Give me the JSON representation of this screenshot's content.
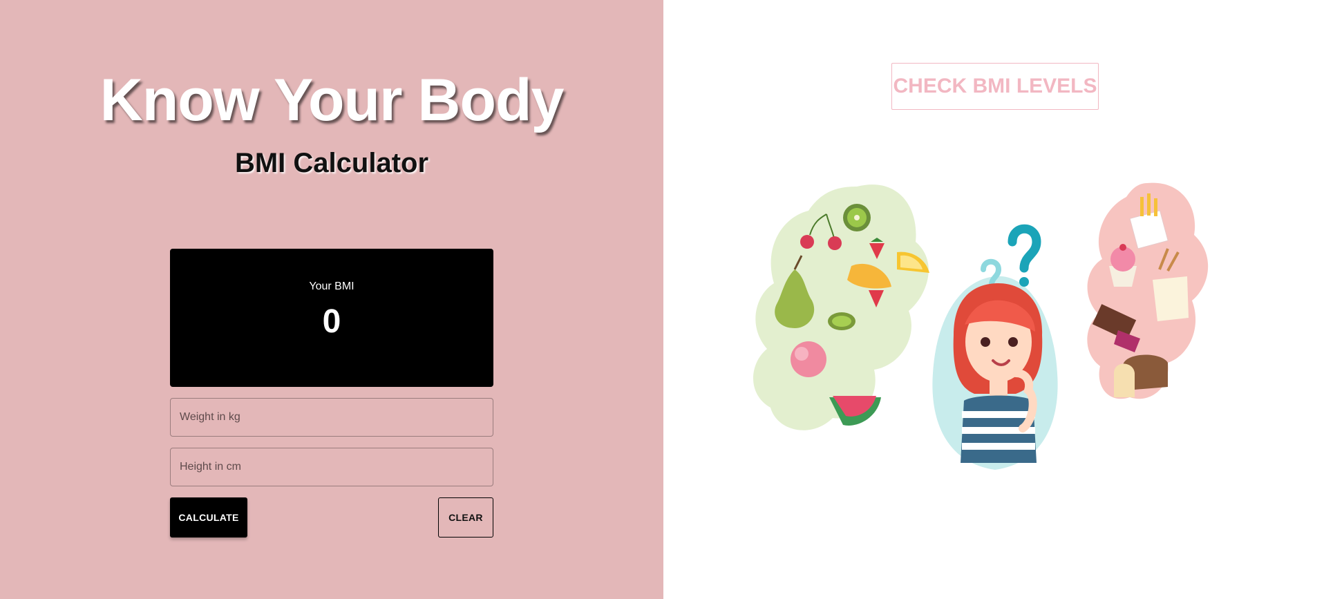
{
  "header": {
    "title": "Know Your Body",
    "subtitle": "BMI Calculator"
  },
  "result": {
    "label": "Your BMI",
    "value": "0"
  },
  "form": {
    "weight_placeholder": "Weight in kg",
    "height_placeholder": "Height in cm",
    "calculate_label": "CALCULATE",
    "clear_label": "CLEAR"
  },
  "levels_button": {
    "label": "CHECK BMI LEVELS"
  },
  "colors": {
    "left_background": "#e3b7b8",
    "right_background": "#ffffff",
    "result_card": "#000000",
    "levels_accent": "#f2b7c2"
  },
  "icons": {
    "illustration": "girl-thinking-about-food-illustration"
  }
}
